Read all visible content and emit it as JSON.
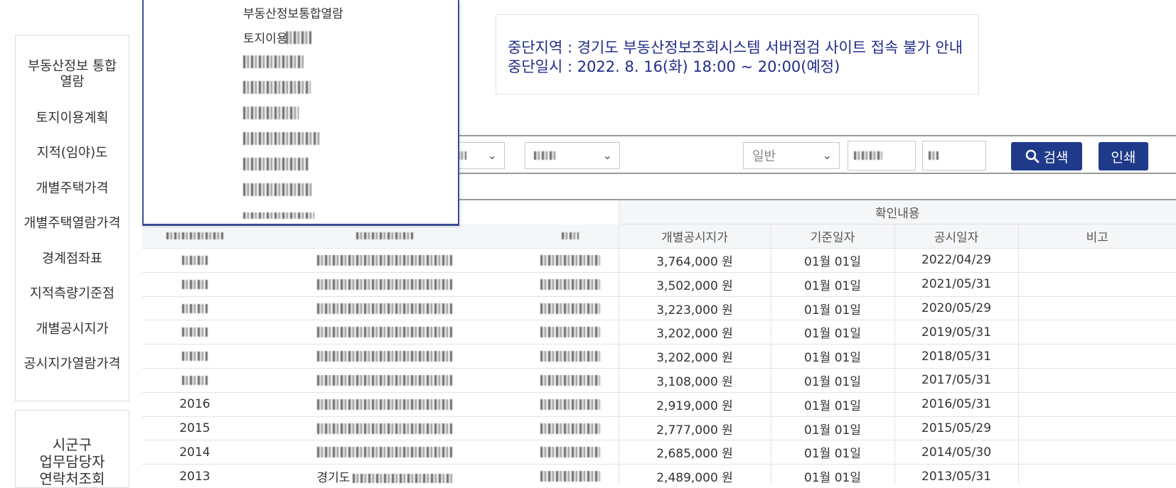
{
  "sidebar": {
    "items": [
      {
        "label": "부동산정보 통합\n열람"
      },
      {
        "label": "토지이용계획"
      },
      {
        "label": "지적(임야)도"
      },
      {
        "label": "개별주택가격"
      },
      {
        "label": "개별주택열람가격"
      },
      {
        "label": "경계점좌표"
      },
      {
        "label": "지적측량기준점"
      },
      {
        "label": "개별공시지가"
      },
      {
        "label": "공시지가열람가격"
      }
    ],
    "contact_label": "시군구\n업무담당자\n연락처조회"
  },
  "dropdown": {
    "items": [
      {
        "label": "부동산정보통합열람"
      },
      {
        "label": "토지이용계획"
      }
    ]
  },
  "notice": {
    "line1": "중단지역 : 경기도 부동산정보조회시스템 서버점검 사이트 접속 불가 안내",
    "line2": "중단일시 : 2022. 8. 16(화) 18:00 ~ 20:00(예정)"
  },
  "search": {
    "type_value": "일반",
    "search_button": "검색",
    "print_button": "인쇄"
  },
  "table": {
    "group_header": "확인내용",
    "headers": {
      "price": "개별공시지가",
      "base_date": "기준일자",
      "notice_date": "공시일자",
      "remark": "비고"
    },
    "rows": [
      {
        "year": "",
        "price": "3,764,000 원",
        "base_date": "01월 01일",
        "notice_date": "2022/04/29"
      },
      {
        "year": "",
        "price": "3,502,000 원",
        "base_date": "01월 01일",
        "notice_date": "2021/05/31"
      },
      {
        "year": "",
        "price": "3,223,000 원",
        "base_date": "01월 01일",
        "notice_date": "2020/05/29"
      },
      {
        "year": "",
        "price": "3,202,000 원",
        "base_date": "01월 01일",
        "notice_date": "2019/05/31"
      },
      {
        "year": "",
        "price": "3,202,000 원",
        "base_date": "01월 01일",
        "notice_date": "2018/05/31"
      },
      {
        "year": "",
        "price": "3,108,000 원",
        "base_date": "01월 01일",
        "notice_date": "2017/05/31"
      },
      {
        "year": "2016",
        "price": "2,919,000 원",
        "base_date": "01월 01일",
        "notice_date": "2016/05/31"
      },
      {
        "year": "2015",
        "price": "2,777,000 원",
        "base_date": "01월 01일",
        "notice_date": "2015/05/29"
      },
      {
        "year": "2014",
        "price": "2,685,000 원",
        "base_date": "01월 01일",
        "notice_date": "2014/05/30"
      },
      {
        "year": "2013",
        "price": "2,489,000 원",
        "base_date": "01월 01일",
        "notice_date": "2013/05/31"
      }
    ],
    "last_row_address_prefix": "경기도"
  },
  "colors": {
    "primary_button": "#1f3a8a",
    "notice_text": "#1f2d8a",
    "dropdown_border": "#3a4e93"
  }
}
